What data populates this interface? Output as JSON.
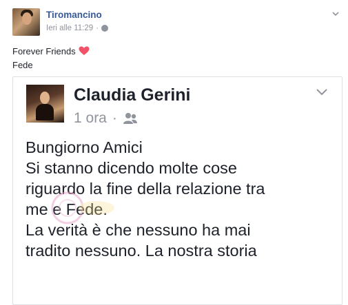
{
  "post": {
    "author": "Tiromancino",
    "time": "Ieri alle 11:29",
    "separator": "·",
    "text_line1": "Forever Friends",
    "text_line2": "Fede"
  },
  "shared": {
    "author": "Claudia Gerini",
    "time": "1 ora",
    "separator": "·",
    "lines": [
      "Bungiorno Amici",
      "Si stanno dicendo molte cose",
      "riguardo la fine della relazione tra",
      "me e Fede.",
      "La verità è che nessuno ha mai",
      "tradito nessuno. La nostra storia"
    ]
  },
  "colors": {
    "link": "#365899",
    "meta": "#90949c",
    "heart": "#f25268"
  },
  "icons": {
    "privacy": "globe-icon",
    "audience": "friends-icon",
    "menu": "chevron-down-icon",
    "emoji": "heart-icon"
  }
}
